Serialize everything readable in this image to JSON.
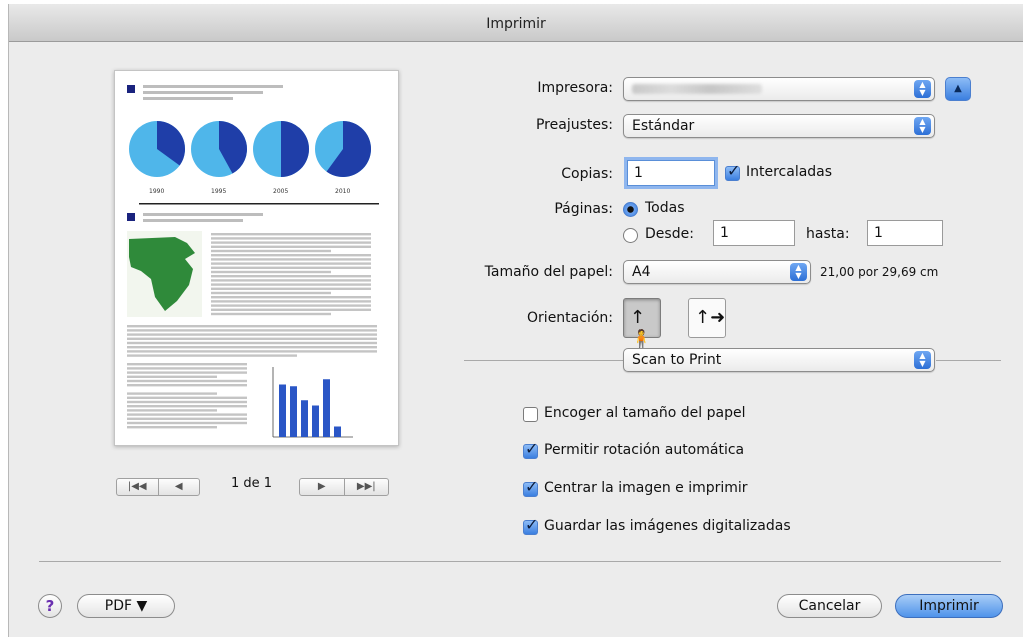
{
  "window": {
    "title": "Imprimir"
  },
  "printer": {
    "label": "Impresora:",
    "value": ""
  },
  "presets": {
    "label": "Preajustes:",
    "value": "Estándar"
  },
  "copies": {
    "label": "Copias:",
    "value": "1",
    "collate_label": "Intercaladas",
    "collate_checked": true
  },
  "pages": {
    "label": "Páginas:",
    "all_label": "Todas",
    "from_label": "Desde:",
    "from_value": "1",
    "to_label": "hasta:",
    "to_value": "1",
    "selected": "all"
  },
  "paper": {
    "label": "Tamaño del papel:",
    "value": "A4",
    "dimensions": "21,00 por 29,69 cm"
  },
  "orientation": {
    "label": "Orientación:",
    "selected": "portrait"
  },
  "section_popup": {
    "value": "Scan to Print"
  },
  "options": [
    {
      "label": "Encoger al tamaño del papel",
      "checked": false
    },
    {
      "label": "Permitir rotación automática",
      "checked": true
    },
    {
      "label": "Centrar la imagen e imprimir",
      "checked": true
    },
    {
      "label": "Guardar las imágenes digitalizadas",
      "checked": true
    }
  ],
  "preview": {
    "page_indicator": "1 de 1",
    "pie_labels": [
      "1990",
      "1995",
      "2005",
      "2010"
    ],
    "bar_chart": {
      "values": [
        6,
        5.8,
        4.2,
        3.6,
        6.6,
        1.2
      ],
      "ymax": 8,
      "color": "#2a56c6"
    }
  },
  "footer": {
    "help": "?",
    "pdf_label": "PDF ▼",
    "cancel_label": "Cancelar",
    "print_label": "Imprimir"
  },
  "colors": {
    "accent": "#3b7fe0",
    "map_green": "#2f8a3a",
    "pie_dark": "#1f3ea8",
    "pie_light": "#4fb6ea"
  }
}
